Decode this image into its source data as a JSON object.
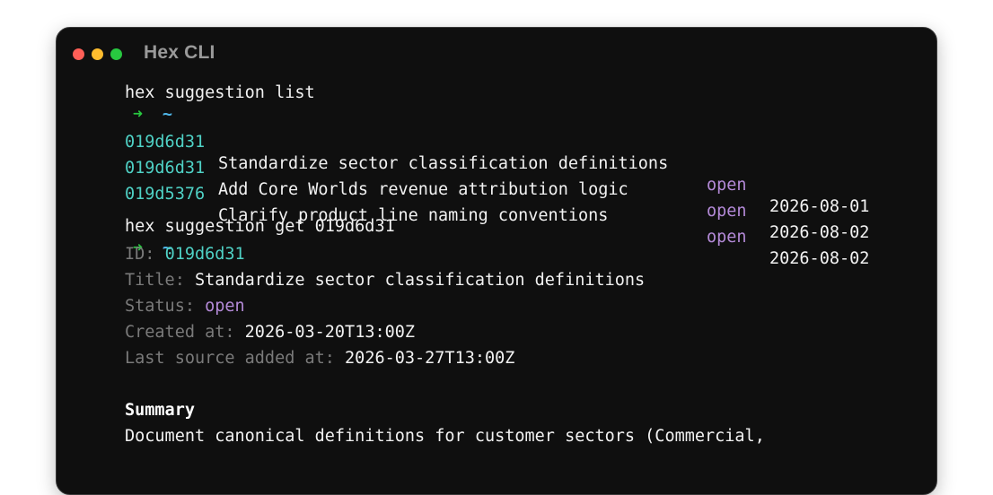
{
  "window": {
    "title": "Hex CLI",
    "colors": {
      "close": "#ff5f57",
      "minimize": "#febc2e",
      "maximize": "#28c840"
    }
  },
  "prompt": {
    "arrow": "➜",
    "dir": "~"
  },
  "commands": [
    {
      "text": "hex suggestion list"
    },
    {
      "text": "hex suggestion get 019d6d31"
    }
  ],
  "list": {
    "rows": [
      {
        "id": "019d6d31",
        "title": "Standardize sector classification definitions",
        "status": "open",
        "date": "2026-08-01"
      },
      {
        "id": "019d6d31",
        "title": "Add Core Worlds revenue attribution logic",
        "status": "open",
        "date": "2026-08-02"
      },
      {
        "id": "019d5376",
        "title": "Clarify product line naming conventions",
        "status": "open",
        "date": "2026-08-02"
      }
    ]
  },
  "detail": {
    "id_label": "ID:",
    "id_value": "019d6d31",
    "title_label": "Title:",
    "title_value": "Standardize sector classification definitions",
    "status_label": "Status:",
    "status_value": "open",
    "created_label": "Created at:",
    "created_value": "2026-03-20T13:00Z",
    "last_source_label": "Last source added at:",
    "last_source_value": "2026-03-27T13:00Z",
    "summary_heading": "Summary",
    "summary_text": "Document canonical definitions for customer sectors (Commercial,"
  },
  "theme": {
    "background": "#0f0f0f",
    "accent_green": "#28c840",
    "accent_blue": "#4fb6e8",
    "id_cyan": "#4fd1c5",
    "status_purple": "#b48ad8"
  }
}
